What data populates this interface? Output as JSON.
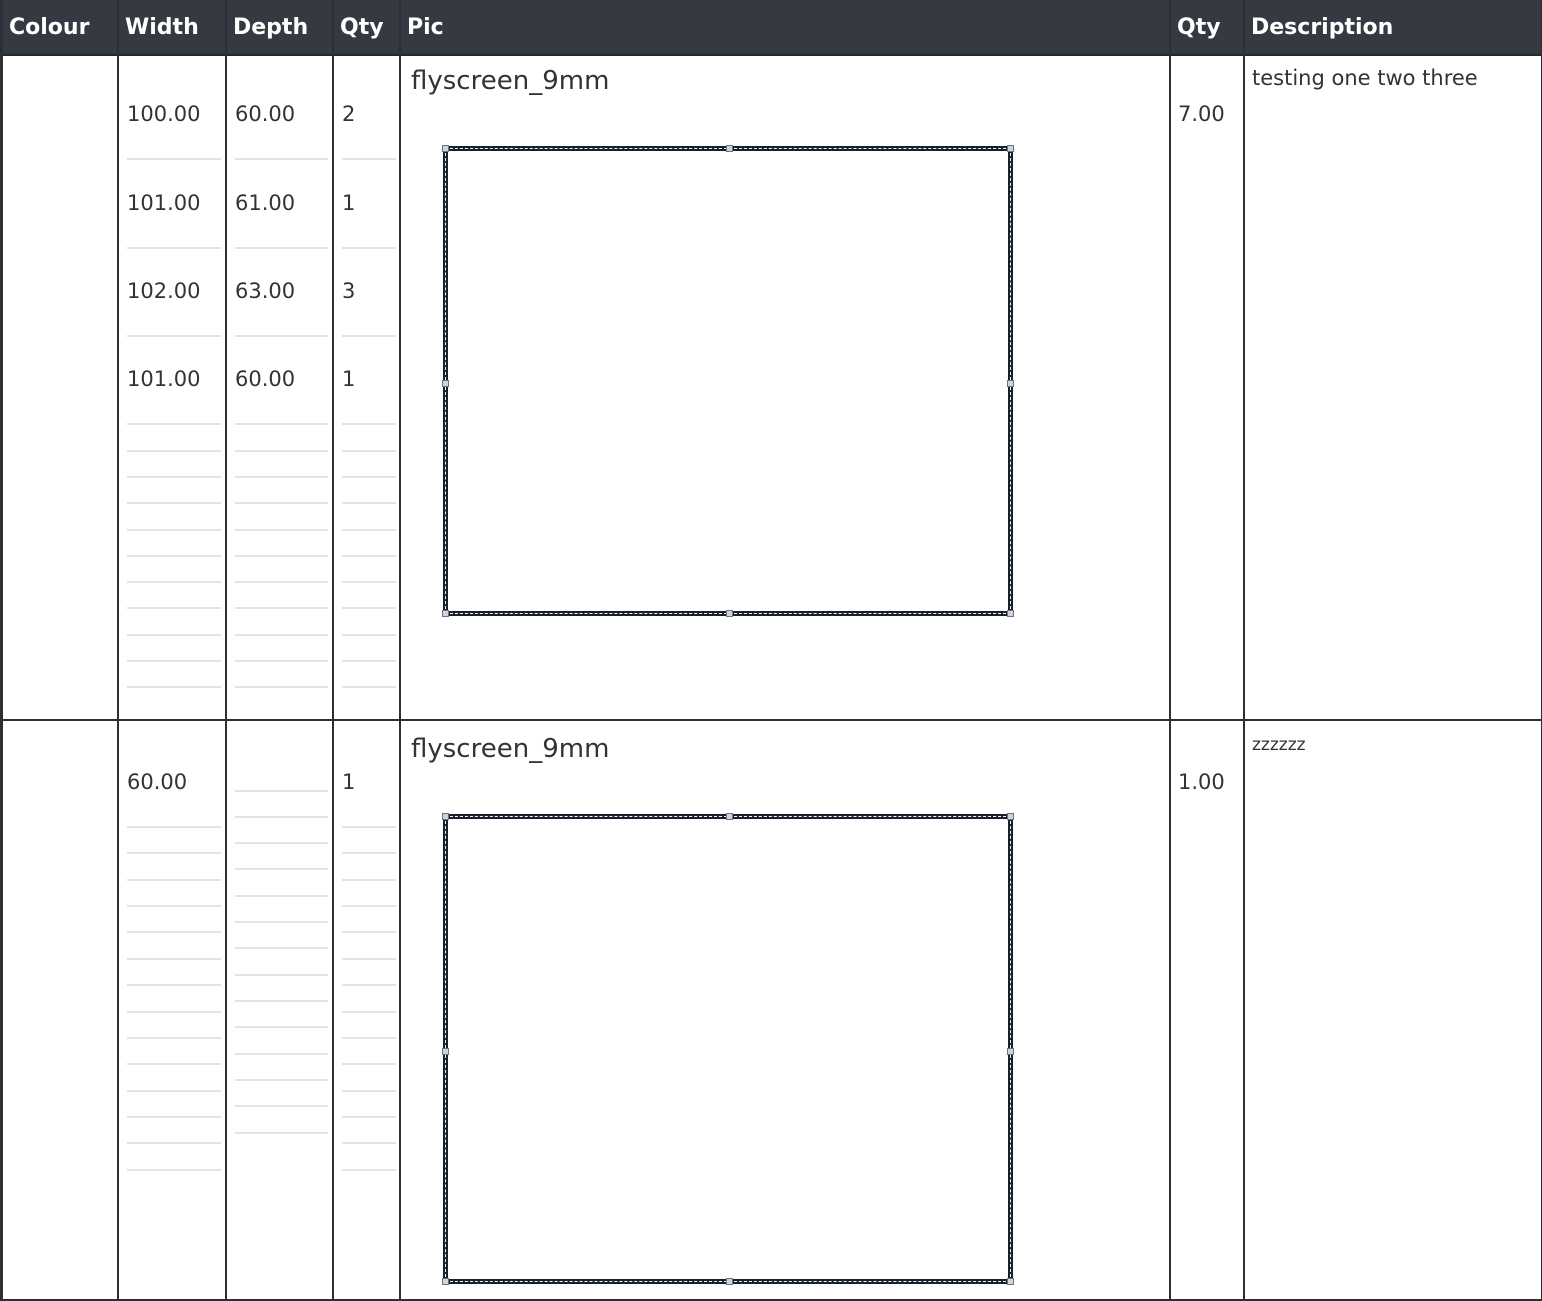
{
  "header": {
    "colour": "Colour",
    "width": "Width",
    "depth": "Depth",
    "qty": "Qty",
    "pic": "Pic",
    "qty2": "Qty",
    "description": "Description"
  },
  "rows": [
    {
      "widths": [
        "100.00",
        "101.00",
        "102.00",
        "101.00"
      ],
      "depths": [
        "60.00",
        "61.00",
        "63.00",
        "60.00"
      ],
      "qtys": [
        "2",
        "1",
        "3",
        "1"
      ],
      "pic_title": "flyscreen_9mm",
      "total_qty": "7.00",
      "description": "testing one two three"
    },
    {
      "widths": [
        "60.00"
      ],
      "depths": [],
      "qtys": [
        "1"
      ],
      "pic_title": "flyscreen_9mm",
      "total_qty": "1.00",
      "description": "zzzzzz"
    }
  ]
}
